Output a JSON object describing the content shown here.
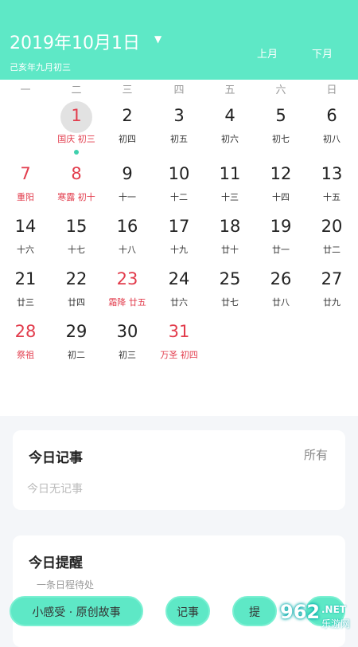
{
  "header": {
    "date": "2019年10月1日",
    "dropdown_icon": "▼",
    "lunar": "己亥年九月初三",
    "prev": "上月",
    "next": "下月"
  },
  "weekdays": [
    "一",
    "二",
    "三",
    "四",
    "五",
    "六",
    "日"
  ],
  "days": [
    {
      "n": "1",
      "s": "国庆 初三",
      "col": 1,
      "row": 0,
      "red": true,
      "selected": true,
      "dot": true
    },
    {
      "n": "2",
      "s": "初四",
      "col": 2,
      "row": 0
    },
    {
      "n": "3",
      "s": "初五",
      "col": 3,
      "row": 0
    },
    {
      "n": "4",
      "s": "初六",
      "col": 4,
      "row": 0
    },
    {
      "n": "5",
      "s": "初七",
      "col": 5,
      "row": 0
    },
    {
      "n": "6",
      "s": "初八",
      "col": 6,
      "row": 0
    },
    {
      "n": "7",
      "s": "重阳",
      "col": 0,
      "row": 1,
      "red": true
    },
    {
      "n": "8",
      "s": "寒露 初十",
      "col": 1,
      "row": 1,
      "red": true
    },
    {
      "n": "9",
      "s": "十一",
      "col": 2,
      "row": 1
    },
    {
      "n": "10",
      "s": "十二",
      "col": 3,
      "row": 1
    },
    {
      "n": "11",
      "s": "十三",
      "col": 4,
      "row": 1
    },
    {
      "n": "12",
      "s": "十四",
      "col": 5,
      "row": 1
    },
    {
      "n": "13",
      "s": "十五",
      "col": 6,
      "row": 1
    },
    {
      "n": "14",
      "s": "十六",
      "col": 0,
      "row": 2
    },
    {
      "n": "15",
      "s": "十七",
      "col": 1,
      "row": 2
    },
    {
      "n": "16",
      "s": "十八",
      "col": 2,
      "row": 2
    },
    {
      "n": "17",
      "s": "十九",
      "col": 3,
      "row": 2
    },
    {
      "n": "18",
      "s": "廿十",
      "col": 4,
      "row": 2
    },
    {
      "n": "19",
      "s": "廿一",
      "col": 5,
      "row": 2
    },
    {
      "n": "20",
      "s": "廿二",
      "col": 6,
      "row": 2
    },
    {
      "n": "21",
      "s": "廿三",
      "col": 0,
      "row": 3
    },
    {
      "n": "22",
      "s": "廿四",
      "col": 1,
      "row": 3
    },
    {
      "n": "23",
      "s": "霜降 廿五",
      "col": 2,
      "row": 3,
      "red": true
    },
    {
      "n": "24",
      "s": "廿六",
      "col": 3,
      "row": 3
    },
    {
      "n": "25",
      "s": "廿七",
      "col": 4,
      "row": 3
    },
    {
      "n": "26",
      "s": "廿八",
      "col": 5,
      "row": 3
    },
    {
      "n": "27",
      "s": "廿九",
      "col": 6,
      "row": 3
    },
    {
      "n": "28",
      "s": "祭祖",
      "col": 0,
      "row": 4,
      "red": true
    },
    {
      "n": "29",
      "s": "初二",
      "col": 1,
      "row": 4
    },
    {
      "n": "30",
      "s": "初三",
      "col": 2,
      "row": 4
    },
    {
      "n": "31",
      "s": "万圣 初四",
      "col": 3,
      "row": 4,
      "red": true
    }
  ],
  "notes_card": {
    "title": "今日记事",
    "all": "所有",
    "empty": "今日无记事"
  },
  "reminder_card": {
    "title": "今日提醒",
    "peek": "一条日程待处"
  },
  "bottom_bar": {
    "story": "小感受 · 原创故事",
    "notes": "记事",
    "third": "提"
  },
  "watermark": {
    "num": "962",
    "net": ".NET",
    "cn": "乐游网"
  },
  "colors": {
    "accent": "#5ee8c6",
    "holiday_red": "#e23c4c",
    "dot": "#3fd0ad"
  }
}
